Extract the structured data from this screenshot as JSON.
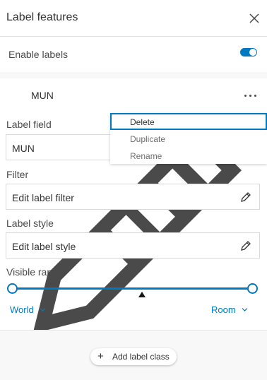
{
  "header": {
    "title": "Label features",
    "close_icon": "close-icon"
  },
  "enable": {
    "label": "Enable labels",
    "enabled": true
  },
  "label_class": {
    "name": "MUN",
    "icon": "label-pencil-icon",
    "more_icon": "more-horizontal-icon"
  },
  "label_field": {
    "label": "Label field",
    "value": "MUN"
  },
  "filter": {
    "label": "Filter",
    "value": "Edit label filter",
    "icon": "pencil-icon"
  },
  "label_style": {
    "label": "Label style",
    "value": "Edit label style",
    "icon": "pencil-icon"
  },
  "visible_range": {
    "label": "Visible range",
    "min_label": "World",
    "max_label": "Room",
    "min_fraction": 0,
    "max_fraction": 1,
    "current_fraction": 0.54
  },
  "context_menu": {
    "items": [
      "Delete",
      "Duplicate",
      "Rename"
    ],
    "focused": "Delete"
  },
  "footer": {
    "add_button_label": "Add label class"
  },
  "colors": {
    "accent": "#0079c1",
    "text": "#323232",
    "band": "#f8f8f8"
  }
}
